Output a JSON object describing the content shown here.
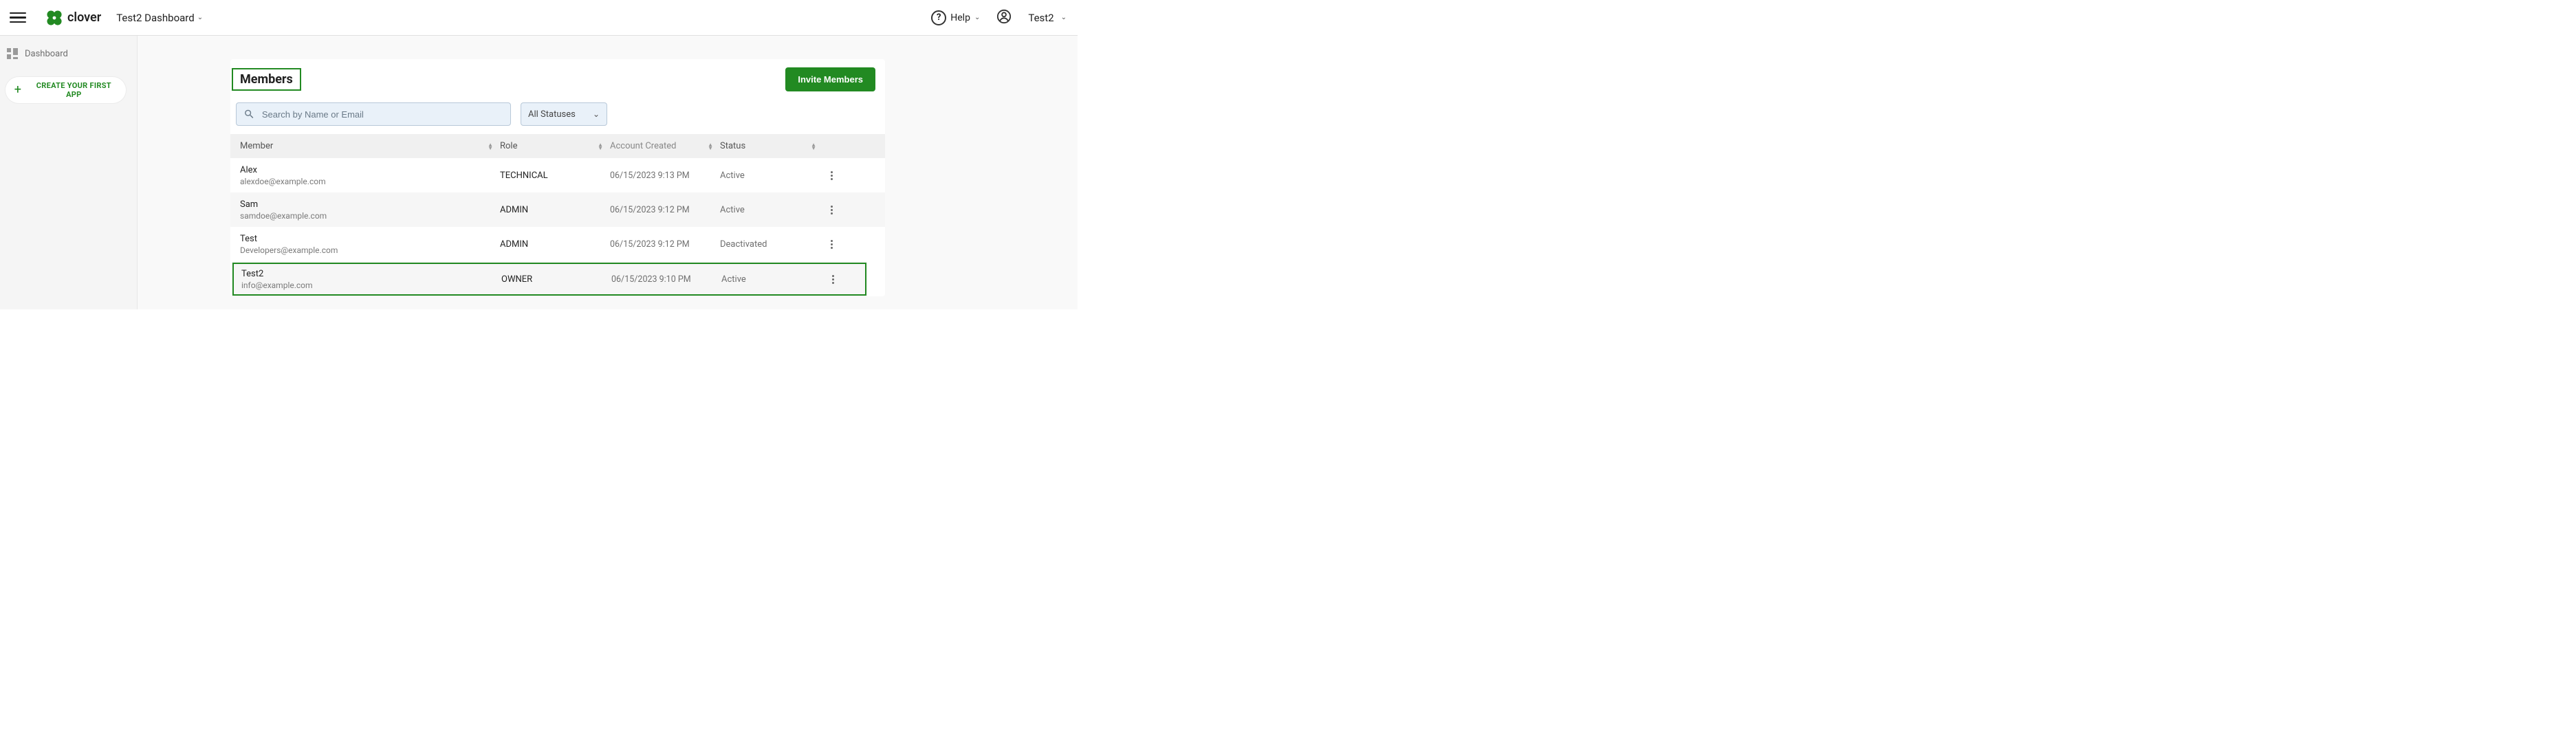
{
  "header": {
    "workspace_name": "Test2 Dashboard",
    "help_label": "Help",
    "user_name": "Test2",
    "logo_text": "clover"
  },
  "sidebar": {
    "dashboard_label": "Dashboard",
    "create_app_label": "CREATE YOUR FIRST APP"
  },
  "members_panel": {
    "title": "Members",
    "invite_label": "Invite Members",
    "search_placeholder": "Search by Name or Email",
    "status_filter_label": "All Statuses",
    "columns": {
      "member": "Member",
      "role": "Role",
      "created": "Account Created",
      "status": "Status"
    },
    "rows": [
      {
        "name": "Alex",
        "email": "alexdoe@example.com",
        "role": "TECHNICAL",
        "created": "06/15/2023 9:13 PM",
        "status": "Active"
      },
      {
        "name": "Sam",
        "email": "samdoe@example.com",
        "role": "ADMIN",
        "created": "06/15/2023 9:12 PM",
        "status": "Active"
      },
      {
        "name": "Test",
        "email": "Developers@example.com",
        "role": "ADMIN",
        "created": "06/15/2023 9:12 PM",
        "status": "Deactivated"
      },
      {
        "name": "Test2",
        "email": "info@example.com",
        "role": "OWNER",
        "created": "06/15/2023 9:10 PM",
        "status": "Active"
      }
    ]
  }
}
